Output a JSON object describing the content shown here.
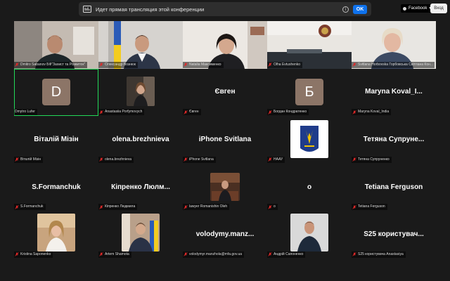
{
  "banner": {
    "text": "Идет прямая трансляция этой конференции",
    "info_glyph": "i",
    "ok_label": "OK"
  },
  "topright": {
    "facebook_label": "Facebook",
    "login_label": "Вход"
  },
  "colors": {
    "background": "#1a1a1a",
    "active_speaker_border": "#23d959",
    "ok_button": "#0e72ed",
    "muted_mic": "#e02828"
  },
  "participants": [
    {
      "label": "Dmitro Sabanov БФ\"Захист та Розвиток\"",
      "kind": "video"
    },
    {
      "label": "Олександр Вознюк",
      "kind": "video"
    },
    {
      "label": "Natalia Максименко",
      "kind": "video"
    },
    {
      "label": "Olha Evtushenko",
      "kind": "video"
    },
    {
      "label": "Svitlana Horbovska Горбовська Світлана Кон...",
      "kind": "video"
    },
    {
      "label": "Dmytro Lufer",
      "kind": "letter",
      "letter": "D"
    },
    {
      "label": "Anastasiia Porfymovych",
      "kind": "photo"
    },
    {
      "label": "Євген",
      "kind": "name",
      "display": "Євген"
    },
    {
      "label": "Богдан Кондратенко",
      "kind": "letter",
      "letter": "Б"
    },
    {
      "label": "Maryna Koval_India",
      "kind": "name",
      "display": "Maryna  Koval_I..."
    },
    {
      "label": "Віталій Мізін",
      "kind": "name",
      "display": "Віталій Мізін"
    },
    {
      "label": "olena.brezhnieva",
      "kind": "name",
      "display": "olena.brezhnieva"
    },
    {
      "label": "iPhone Svitlana",
      "kind": "name",
      "display": "iPhone Svitlana"
    },
    {
      "label": "НААУ",
      "kind": "logo"
    },
    {
      "label": "Тетяна Супруненко",
      "kind": "name",
      "display": "Тетяна  Супруне..."
    },
    {
      "label": "S.Formanchuk",
      "kind": "name",
      "display": "S.Formanchuk"
    },
    {
      "label": "Кіпренко Людмила",
      "kind": "name",
      "display": "Кіпренко  Люлм..."
    },
    {
      "label": "lawyer Romanishin Oleh",
      "kind": "photo"
    },
    {
      "label": "о",
      "kind": "name",
      "display": "о"
    },
    {
      "label": "Tetiana Ferguson",
      "kind": "name",
      "display": "Tetiana Ferguson"
    },
    {
      "label": "Kristina Saponenko",
      "kind": "photo"
    },
    {
      "label": "Artem Shamota",
      "kind": "photo"
    },
    {
      "label": "volodymyr.manzhola@mfa.gov.ua",
      "kind": "name",
      "display": "volodymy.manz..."
    },
    {
      "label": "Андрій Сапоненко",
      "kind": "photo"
    },
    {
      "label": "S25 користувача Anastasiya",
      "kind": "name",
      "display": "S25  користувач..."
    }
  ]
}
